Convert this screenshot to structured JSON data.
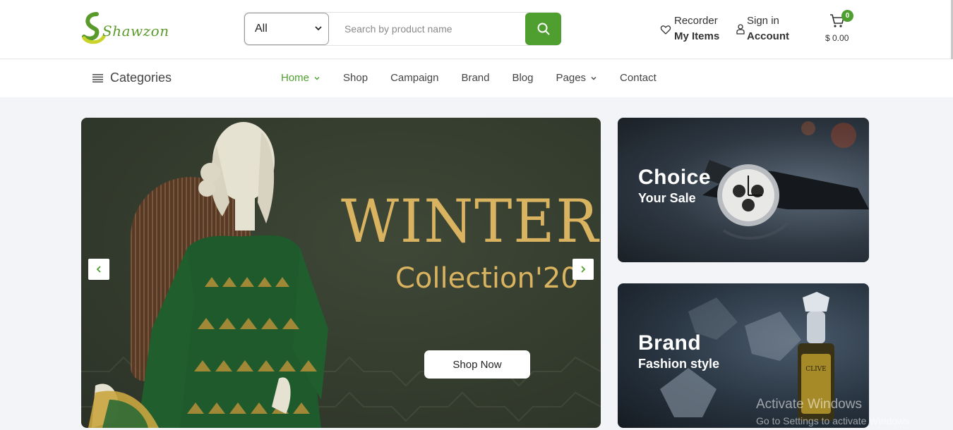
{
  "logo": {
    "text": "Shawzon"
  },
  "search": {
    "category_selected": "All",
    "placeholder": "Search by product name"
  },
  "header": {
    "recorder_top": "Recorder",
    "recorder_bottom": "My Items",
    "account_top": "Sign in",
    "account_bottom": "Account",
    "cart_count": "0",
    "cart_total": "$ 0.00"
  },
  "nav": {
    "categories_label": "Categories",
    "items": [
      {
        "label": "Home",
        "dropdown": true,
        "active": true
      },
      {
        "label": "Shop",
        "dropdown": false
      },
      {
        "label": "Campaign",
        "dropdown": false
      },
      {
        "label": "Brand",
        "dropdown": false
      },
      {
        "label": "Blog",
        "dropdown": false
      },
      {
        "label": "Pages",
        "dropdown": true
      },
      {
        "label": "Contact",
        "dropdown": false
      }
    ]
  },
  "hero": {
    "title": "WINTER",
    "subtitle": "Collection'20",
    "button": "Shop Now"
  },
  "banners": [
    {
      "title": "Choice",
      "subtitle": "Your Sale"
    },
    {
      "title": "Brand",
      "subtitle": "Fashion style"
    }
  ],
  "watermark": {
    "line1": "Activate Windows",
    "line2": "Go to Settings to activate Windows."
  },
  "colors": {
    "accent": "#4e9f2f",
    "gold": "#d9b35f"
  }
}
